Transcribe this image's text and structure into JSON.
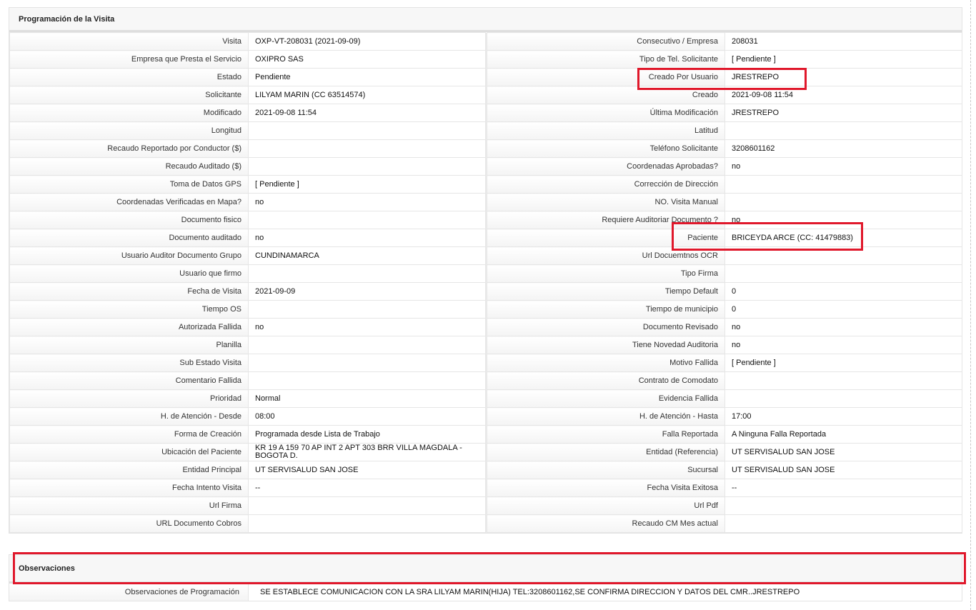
{
  "main_panel": {
    "title": "Programación de la Visita",
    "rows": [
      {
        "l1": "Visita",
        "v1": "OXP-VT-208031 (2021-09-09)",
        "l2": "Consecutivo / Empresa",
        "v2": "208031"
      },
      {
        "l1": "Empresa que Presta el Servicio",
        "v1": "OXIPRO SAS",
        "l2": "Tipo de Tel. Solicitante",
        "v2": "[ Pendiente ]"
      },
      {
        "l1": "Estado",
        "v1": "Pendiente",
        "l2": "Creado Por Usuario",
        "v2": "JRESTREPO"
      },
      {
        "l1": "Solicitante",
        "v1": "LILYAM MARIN (CC 63514574)",
        "l2": "Creado",
        "v2": "2021-09-08 11:54"
      },
      {
        "l1": "Modificado",
        "v1": "2021-09-08 11:54",
        "l2": "Última Modificación",
        "v2": " JRESTREPO"
      },
      {
        "l1": "Longitud",
        "v1": "",
        "l2": "Latitud",
        "v2": ""
      },
      {
        "l1": "Recaudo Reportado por Conductor ($)",
        "v1": "",
        "l2": "Teléfono Solicitante",
        "v2": "3208601162"
      },
      {
        "l1": "Recaudo Auditado ($)",
        "v1": "",
        "l2": "Coordenadas Aprobadas?",
        "v2": " no"
      },
      {
        "l1": "Toma de Datos GPS",
        "v1": "[ Pendiente ]",
        "l2": "Corrección de Dirección",
        "v2": ""
      },
      {
        "l1": "Coordenadas Verificadas en Mapa?",
        "v1": " no",
        "l2": "NO. Visita Manual",
        "v2": ""
      },
      {
        "l1": "Documento fisico",
        "v1": "",
        "l2": "Requiere Auditoriar Documento ?",
        "v2": " no"
      },
      {
        "l1": "Documento auditado",
        "v1": " no",
        "l2": "Paciente",
        "v2": "BRICEYDA ARCE (CC: 41479883)"
      },
      {
        "l1": "Usuario Auditor Documento Grupo",
        "v1": "CUNDINAMARCA",
        "l2": "Url Docuemtnos OCR",
        "v2": ""
      },
      {
        "l1": "Usuario que firmo",
        "v1": "",
        "l2": "Tipo Firma",
        "v2": ""
      },
      {
        "l1": "Fecha de Visita",
        "v1": " 2021-09-09",
        "l2": "Tiempo Default",
        "v2": "0"
      },
      {
        "l1": "Tiempo OS",
        "v1": "",
        "l2": "Tiempo de municipio",
        "v2": "0"
      },
      {
        "l1": "Autorizada Fallida",
        "v1": " no",
        "l2": "Documento Revisado",
        "v2": " no"
      },
      {
        "l1": "Planilla",
        "v1": "",
        "l2": "Tiene Novedad Auditoria",
        "v2": " no"
      },
      {
        "l1": "Sub Estado Visita",
        "v1": "",
        "l2": "Motivo Fallida",
        "v2": "[ Pendiente ]"
      },
      {
        "l1": "Comentario Fallida",
        "v1": "",
        "l2": "Contrato de Comodato",
        "v2": ""
      },
      {
        "l1": "Prioridad",
        "v1": "Normal",
        "l2": "Evidencia Fallida",
        "v2": ""
      },
      {
        "l1": "H. de Atención - Desde",
        "v1": "08:00",
        "l2": "H. de Atención - Hasta",
        "v2": "17:00"
      },
      {
        "l1": "Forma de Creación",
        "v1": "Programada desde Lista de Trabajo",
        "l2": "Falla Reportada",
        "v2": "A Ninguna Falla Reportada"
      },
      {
        "l1": "Ubicación del Paciente",
        "v1": "KR 19 A 159 70 AP INT 2 APT 303 BRR VILLA MAGDALA - BOGOTA D.",
        "l2": "Entidad (Referencia)",
        "v2": "UT SERVISALUD SAN JOSE"
      },
      {
        "l1": "Entidad Principal",
        "v1": "UT SERVISALUD SAN JOSE",
        "l2": "Sucursal",
        "v2": "UT SERVISALUD SAN JOSE"
      },
      {
        "l1": "Fecha Intento Visita",
        "v1": " --",
        "l2": "Fecha Visita Exitosa",
        "v2": " --"
      },
      {
        "l1": "Url Firma",
        "v1": "",
        "l2": "Url Pdf",
        "v2": ""
      },
      {
        "l1": "URL Documento Cobros",
        "v1": "",
        "l2": "Recaudo CM Mes actual",
        "v2": ""
      }
    ]
  },
  "observations_panel": {
    "title": "Observaciones",
    "label": "Observaciones de Programación",
    "value": "SE ESTABLECE COMUNICACION CON LA SRA LILYAM MARIN(HIJA) TEL:3208601162,SE CONFIRMA DIRECCION Y DATOS DEL CMR..JRESTREPO"
  },
  "highlight_color": "#e0182b"
}
